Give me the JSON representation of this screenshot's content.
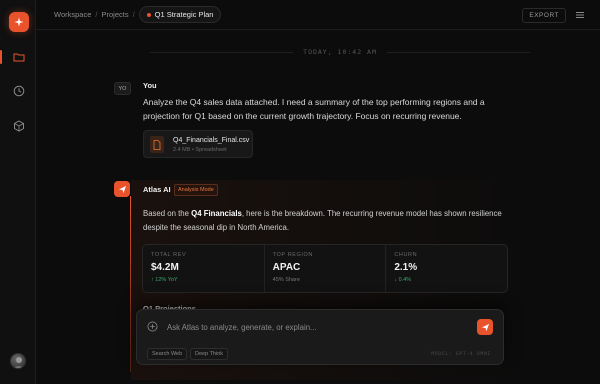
{
  "header": {
    "breadcrumb": [
      "Workspace",
      "Projects"
    ],
    "separator": "/",
    "current": "Q1 Strategic Plan",
    "export_label": "EXPORT"
  },
  "sidebar": {
    "items": [
      {
        "icon": "folder-icon",
        "active": true
      },
      {
        "icon": "clock-icon",
        "active": false
      },
      {
        "icon": "hexagon-icon",
        "active": false
      }
    ]
  },
  "timestamp": "TODAY, 10:42 AM",
  "user_message": {
    "avatar_initials": "YO",
    "name": "You",
    "text": "Analyze the Q4 sales data attached. I need a summary of the top performing regions and a projection for Q1 based on the current growth trajectory. Focus on recurring revenue.",
    "attachment": {
      "name": "Q4_Financials_Final.csv",
      "meta": "2.4 MB • Spreadsheet"
    }
  },
  "ai_message": {
    "name": "Atlas AI",
    "mode_badge": "Analysis Mode",
    "intro_pre": "Based on the ",
    "intro_bold": "Q4 Financials",
    "intro_post": ", here is the breakdown. The recurring revenue model has shown resilience despite the seasonal dip in North America.",
    "stats": [
      {
        "label": "TOTAL REV",
        "value": "$4.2M",
        "sub": "↑ 12% YoY",
        "trend": "up"
      },
      {
        "label": "TOP REGION",
        "value": "APAC",
        "sub": "45% Share",
        "trend": "neutral"
      },
      {
        "label": "CHURN",
        "value": "2.1%",
        "sub": "↓ 0.4%",
        "trend": "up"
      }
    ],
    "projections_heading": "Q1 Projections"
  },
  "composer": {
    "placeholder": "Ask Atlas to analyze, generate, or explain...",
    "chips": [
      "Search Web",
      "Deep Think"
    ],
    "model_label": "MODEL: GPT-4 OMNI"
  },
  "colors": {
    "accent": "#e8532b",
    "positive": "#3fa76a",
    "background": "#0c0c0c"
  }
}
